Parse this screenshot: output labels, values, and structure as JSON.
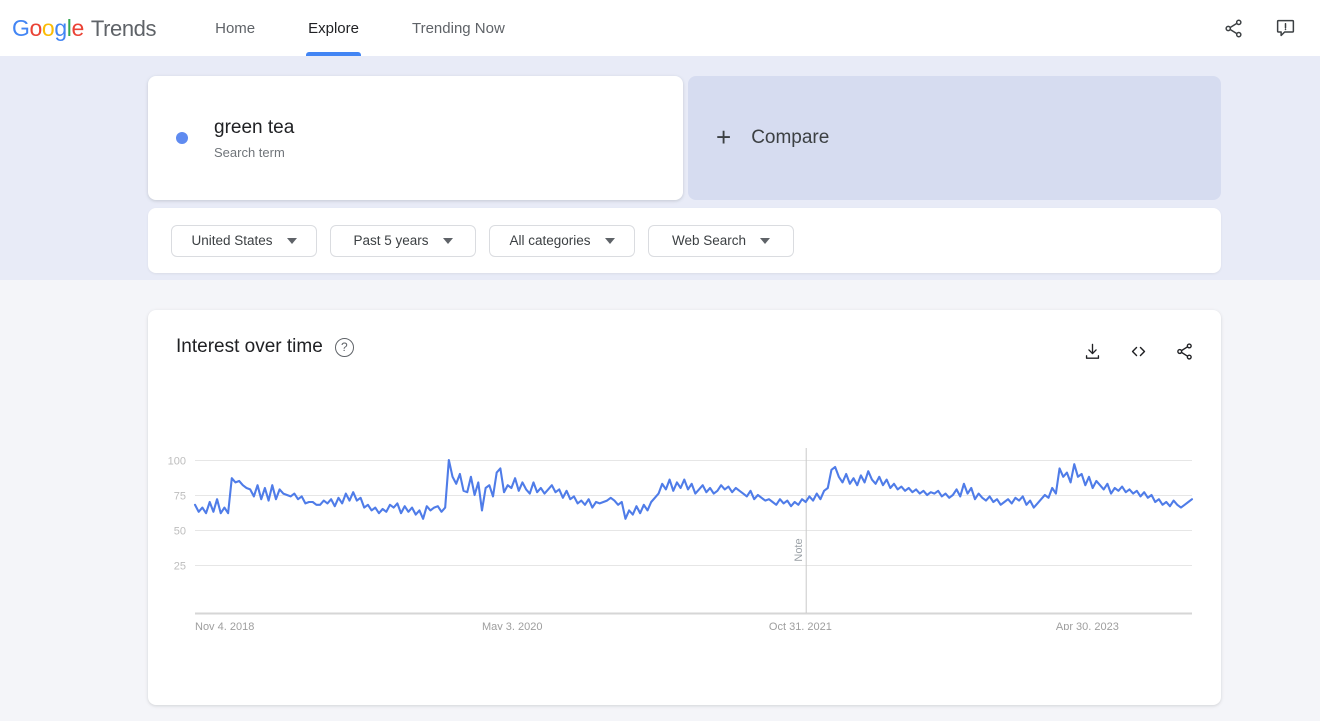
{
  "header": {
    "logo": {
      "google": "Google",
      "product": "Trends"
    },
    "nav": [
      {
        "label": "Home",
        "active": false
      },
      {
        "label": "Explore",
        "active": true
      },
      {
        "label": "Trending Now",
        "active": false
      }
    ],
    "actions": [
      {
        "name": "share-icon",
        "label": "Share"
      },
      {
        "name": "feedback-icon",
        "label": "Send feedback"
      }
    ]
  },
  "search": {
    "term": "green tea",
    "type": "Search term",
    "dot_color": "#5f8bf0",
    "compare_label": "Compare",
    "compare_plus": "+"
  },
  "filters": [
    {
      "name": "location-filter",
      "value": "United States"
    },
    {
      "name": "time-range-filter",
      "value": "Past 5 years"
    },
    {
      "name": "category-filter",
      "value": "All categories"
    },
    {
      "name": "search-type-filter",
      "value": "Web Search"
    }
  ],
  "chart_card": {
    "title": "Interest over time",
    "help_glyph": "?",
    "actions": [
      {
        "name": "download-csv-icon",
        "label": "Download"
      },
      {
        "name": "embed-code-icon",
        "label": "Embed"
      },
      {
        "name": "share-chart-icon",
        "label": "Share"
      }
    ]
  },
  "chart_data": {
    "type": "line",
    "title": "Interest over time",
    "xlabel": "",
    "ylabel": "",
    "ylim": [
      0,
      100
    ],
    "grid": true,
    "legend": false,
    "series_color": "#4f7ce8",
    "ytick_labels": [
      "100",
      "75",
      "50",
      "25"
    ],
    "ytick_values": [
      100,
      75,
      50,
      25
    ],
    "xtick_labels": [
      "Nov 4, 2018",
      "May 3, 2020",
      "Oct 31, 2021",
      "Apr 30, 2023"
    ],
    "xtick_indices": [
      0,
      78,
      156,
      234
    ],
    "annotations": [
      {
        "label": "Note",
        "x_index": 166,
        "orientation": "vertical"
      }
    ],
    "series": [
      {
        "name": "green tea",
        "values": [
          68,
          63,
          66,
          62,
          70,
          63,
          72,
          62,
          66,
          62,
          87,
          84,
          85,
          82,
          80,
          79,
          74,
          82,
          72,
          80,
          71,
          82,
          72,
          79,
          76,
          75,
          74,
          76,
          72,
          74,
          69,
          70,
          70,
          68,
          68,
          71,
          69,
          72,
          67,
          73,
          69,
          76,
          71,
          77,
          71,
          73,
          66,
          68,
          64,
          66,
          62,
          65,
          63,
          68,
          66,
          69,
          62,
          67,
          63,
          66,
          61,
          64,
          58,
          67,
          64,
          66,
          67,
          63,
          66,
          100,
          88,
          83,
          90,
          78,
          77,
          88,
          75,
          84,
          64,
          80,
          82,
          74,
          91,
          94,
          77,
          82,
          80,
          87,
          78,
          84,
          79,
          76,
          84,
          77,
          80,
          76,
          79,
          82,
          77,
          79,
          73,
          78,
          72,
          74,
          69,
          71,
          68,
          72,
          66,
          70,
          69,
          70,
          71,
          73,
          71,
          68,
          70,
          58,
          64,
          61,
          67,
          62,
          68,
          64,
          70,
          73,
          76,
          83,
          79,
          86,
          78,
          84,
          80,
          86,
          79,
          83,
          76,
          79,
          82,
          77,
          80,
          76,
          78,
          82,
          79,
          81,
          77,
          80,
          78,
          76,
          74,
          78,
          72,
          75,
          73,
          71,
          72,
          70,
          68,
          72,
          69,
          71,
          67,
          70,
          68,
          72,
          70,
          74,
          71,
          76,
          72,
          78,
          80,
          93,
          95,
          88,
          84,
          90,
          83,
          87,
          82,
          89,
          84,
          92,
          86,
          83,
          88,
          82,
          86,
          80,
          83,
          79,
          81,
          78,
          80,
          77,
          79,
          76,
          78,
          75,
          77,
          76,
          78,
          74,
          76,
          73,
          75,
          79,
          74,
          83,
          76,
          80,
          72,
          76,
          73,
          71,
          74,
          70,
          72,
          68,
          70,
          72,
          69,
          73,
          71,
          74,
          68,
          71,
          66,
          69,
          72,
          75,
          73,
          80,
          76,
          94,
          88,
          91,
          84,
          97,
          88,
          90,
          82,
          88,
          80,
          85,
          82,
          79,
          83,
          76,
          80,
          78,
          81,
          77,
          79,
          76,
          78,
          74,
          77,
          73,
          75,
          70,
          72,
          68,
          70,
          67,
          71,
          68,
          66,
          68,
          70,
          72
        ]
      }
    ]
  }
}
